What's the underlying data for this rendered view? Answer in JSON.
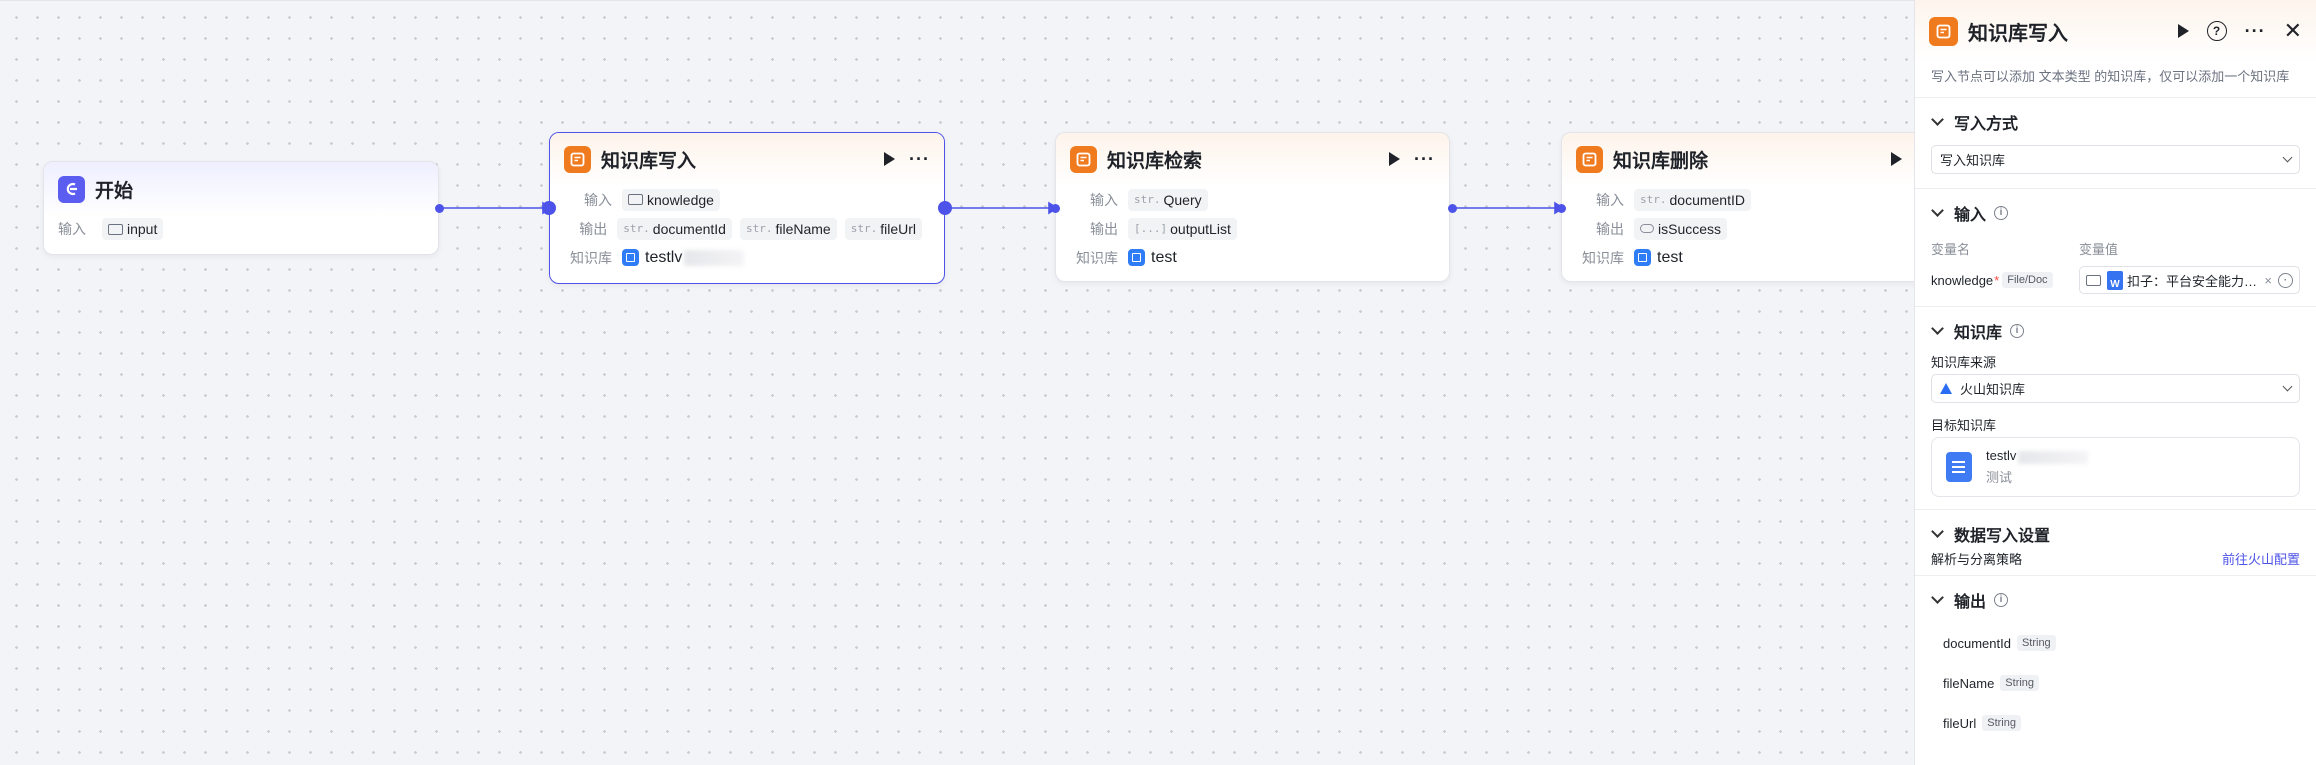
{
  "nodes": {
    "start": {
      "title": "开始",
      "input_label": "输入",
      "input_value": "input"
    },
    "write": {
      "title": "知识库写入",
      "input_label": "输入",
      "input_value": "knowledge",
      "output_label": "输出",
      "outputs": [
        {
          "type": "str.",
          "name": "documentId"
        },
        {
          "type": "str.",
          "name": "fileName"
        },
        {
          "type": "str.",
          "name": "fileUrl"
        }
      ],
      "kb_label": "知识库",
      "kb_value": "testlv"
    },
    "search": {
      "title": "知识库检索",
      "input_label": "输入",
      "input_type": "str.",
      "input_value": "Query",
      "output_label": "输出",
      "output_type": "[...]",
      "output_value": "outputList",
      "kb_label": "知识库",
      "kb_value": "test"
    },
    "delete": {
      "title": "知识库删除",
      "input_label": "输入",
      "input_type": "str.",
      "input_value": "documentID",
      "output_label": "输出",
      "output_value": "isSuccess",
      "kb_label": "知识库",
      "kb_value": "test"
    }
  },
  "panel": {
    "title": "知识库写入",
    "description": "写入节点可以添加 文本类型 的知识库，仅可以添加一个知识库",
    "write_mode": {
      "title": "写入方式",
      "value": "写入知识库"
    },
    "input": {
      "title": "输入",
      "col_name": "变量名",
      "col_value": "变量值",
      "var_name": "knowledge",
      "var_required": "*",
      "var_type": "File/Doc",
      "var_value": "扣子：平台安全能力全面解析",
      "clear_label": "×"
    },
    "kb": {
      "title": "知识库",
      "source_label": "知识库来源",
      "source_value": "火山知识库",
      "target_label": "目标知识库",
      "card_name": "testlv",
      "card_desc": "测试"
    },
    "data_write": {
      "title": "数据写入设置",
      "strategy_label": "解析与分离策略",
      "link": "前往火山配置"
    },
    "output": {
      "title": "输出",
      "items": [
        {
          "name": "documentId",
          "type": "String"
        },
        {
          "name": "fileName",
          "type": "String"
        },
        {
          "name": "fileUrl",
          "type": "String"
        }
      ]
    }
  },
  "colors": {
    "accent": "#4d53e8",
    "node_icon": "#f07b1e",
    "start_icon": "#5b5cf0"
  }
}
